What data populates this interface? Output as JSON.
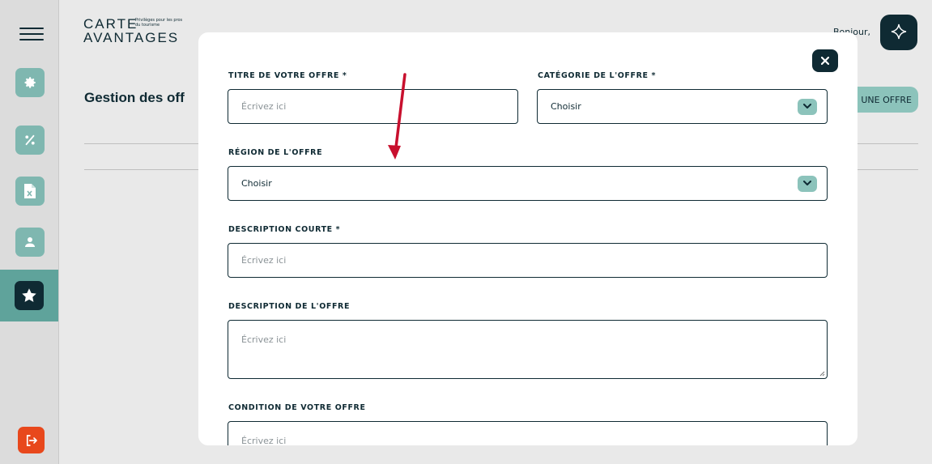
{
  "brand": {
    "logo_line1": "CARTE",
    "logo_line2": "AVANTAGES",
    "logo_tagline": "Privilèges pour les pros du tourisme"
  },
  "header": {
    "greeting": "Bonjour,"
  },
  "page": {
    "title": "Gestion des off",
    "add_button_label": "UNE OFFRE"
  },
  "sidebar": {
    "items": [
      {
        "icon": "gear-icon"
      },
      {
        "icon": "percent-icon"
      },
      {
        "icon": "excel-file-icon"
      },
      {
        "icon": "user-icon"
      },
      {
        "icon": "star-icon",
        "active": true
      }
    ],
    "logout_icon": "logout-icon"
  },
  "modal": {
    "fields": {
      "title": {
        "label": "TITRE DE VOTRE OFFRE *",
        "placeholder": "Écrivez ici"
      },
      "category": {
        "label": "CATÉGORIE DE L'OFFRE *",
        "value": "Choisir"
      },
      "region": {
        "label": "RÉGION DE L'OFFRE",
        "value": "Choisir"
      },
      "short_description": {
        "label": "DESCRIPTION COURTE *",
        "placeholder": "Écrivez ici"
      },
      "description": {
        "label": "DESCRIPTION DE L'OFFRE",
        "placeholder": "Écrivez ici"
      },
      "condition": {
        "label": "CONDITION DE VOTRE OFFRE",
        "placeholder": "Écrivez ici"
      }
    }
  },
  "colors": {
    "dark": "#0f2a33",
    "accent": "#8cc3bb",
    "sidebar_active": "#5fa39b",
    "logout": "#e8481c",
    "annotation_arrow": "#c8102e"
  }
}
